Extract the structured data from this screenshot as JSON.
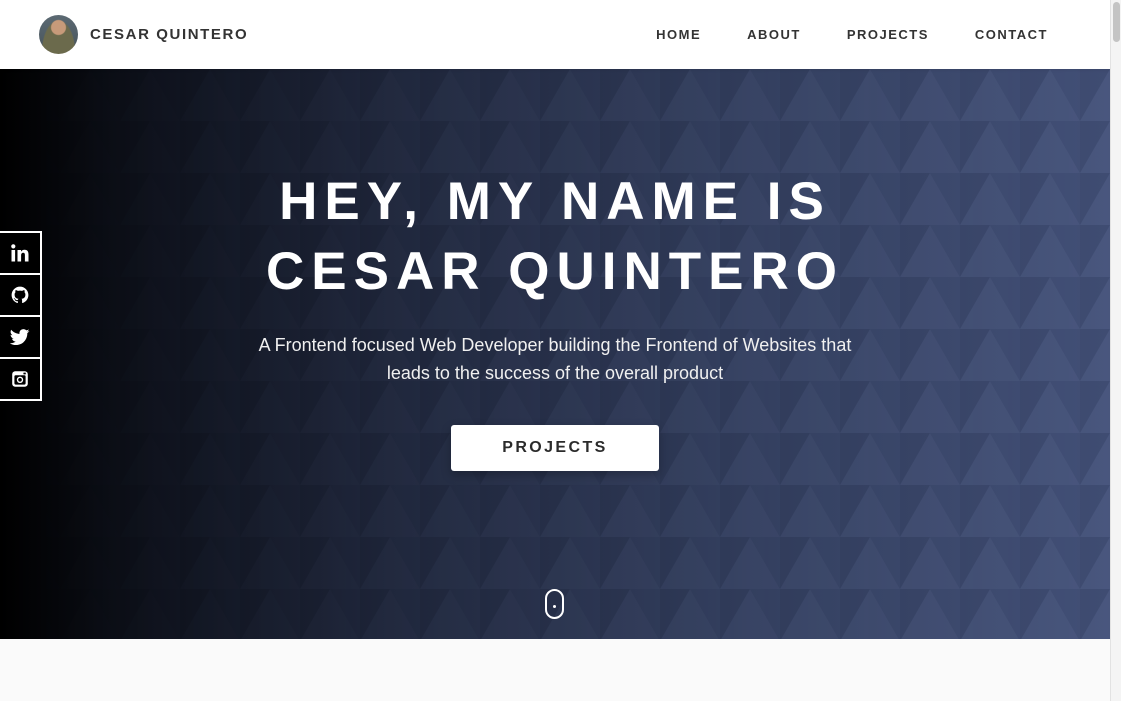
{
  "header": {
    "brand_name": "CESAR QUINTERO",
    "nav": [
      {
        "label": "HOME"
      },
      {
        "label": "ABOUT"
      },
      {
        "label": "PROJECTS"
      },
      {
        "label": "CONTACT"
      }
    ]
  },
  "hero": {
    "title": "HEY, MY NAME IS CESAR QUINTERO",
    "subtitle": "A Frontend focused Web Developer building the Frontend of Websites that leads to the success of the overall product",
    "button_label": "PROJECTS"
  },
  "social": {
    "items": [
      {
        "icon": "linkedin-icon"
      },
      {
        "icon": "github-icon"
      },
      {
        "icon": "twitter-icon"
      },
      {
        "icon": "instagram-icon"
      }
    ]
  },
  "colors": {
    "hero_start": "#000000",
    "hero_end": "#3f4c72",
    "header_bg": "#ffffff",
    "text_dark": "#333333",
    "below_bg": "#fafafa"
  }
}
